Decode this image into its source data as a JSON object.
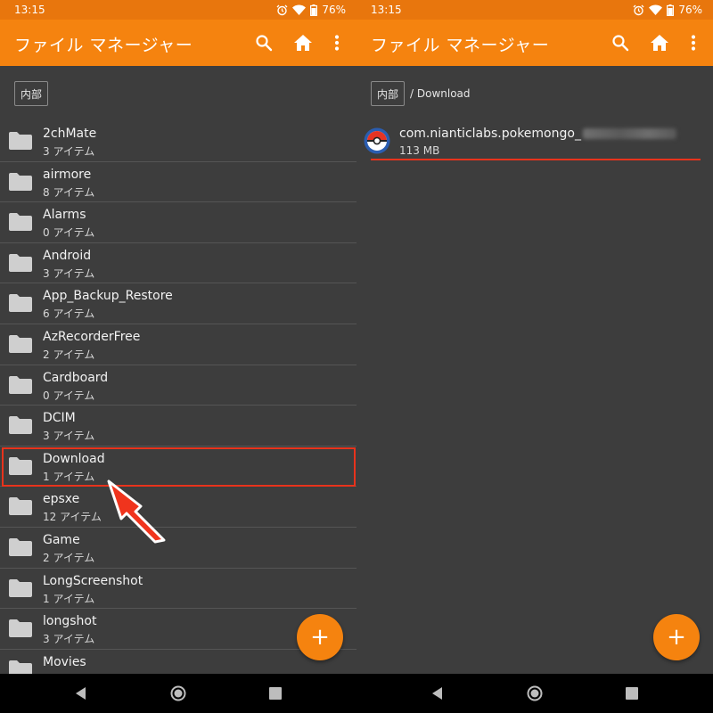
{
  "status": {
    "time": "13:15",
    "battery": "76%"
  },
  "app": {
    "title": "ファイル マネージャー"
  },
  "left": {
    "breadcrumb_root": "内部",
    "folders": [
      {
        "name": "2chMate",
        "count": "3 アイテム"
      },
      {
        "name": "airmore",
        "count": "8 アイテム"
      },
      {
        "name": "Alarms",
        "count": "0 アイテム"
      },
      {
        "name": "Android",
        "count": "3 アイテム"
      },
      {
        "name": "App_Backup_Restore",
        "count": "6 アイテム"
      },
      {
        "name": "AzRecorderFree",
        "count": "2 アイテム"
      },
      {
        "name": "Cardboard",
        "count": "0 アイテム"
      },
      {
        "name": "DCIM",
        "count": "3 アイテム"
      },
      {
        "name": "Download",
        "count": "1 アイテム"
      },
      {
        "name": "epsxe",
        "count": "12 アイテム"
      },
      {
        "name": "Game",
        "count": "2 アイテム"
      },
      {
        "name": "LongScreenshot",
        "count": "1 アイテム"
      },
      {
        "name": "longshot",
        "count": "3 アイテム"
      },
      {
        "name": "Movies",
        "count": ""
      }
    ],
    "fab_label": "+"
  },
  "right": {
    "breadcrumb_root": "内部",
    "breadcrumb_path": "/ Download",
    "file": {
      "name": "com.nianticlabs.pokemongo_",
      "size": "113 MB"
    },
    "fab_label": "+"
  },
  "colors": {
    "accent": "#f5830f",
    "status_bar": "#e8760d",
    "background": "#3d3d3d",
    "highlight": "#e8331c"
  },
  "icons": [
    "search-icon",
    "home-icon",
    "more-vert-icon",
    "folder-icon",
    "pokeball-icon",
    "back-icon",
    "home-nav-icon",
    "recents-icon",
    "alarm-icon",
    "wifi-icon",
    "battery-icon"
  ]
}
